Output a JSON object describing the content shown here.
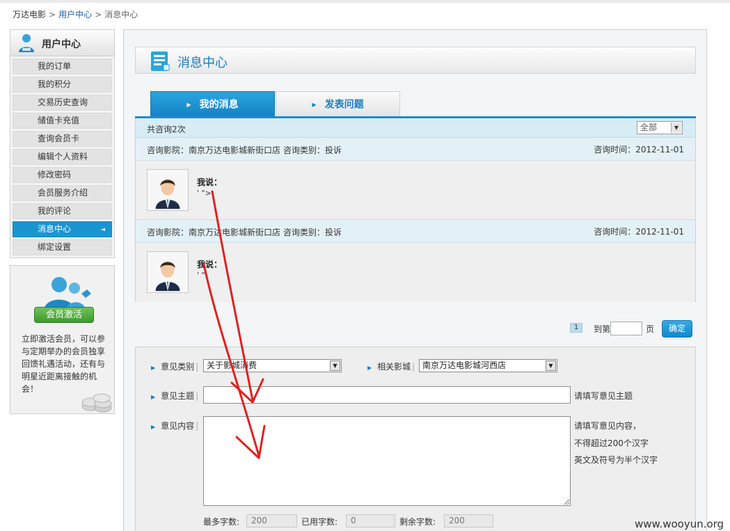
{
  "breadcrumb": {
    "home": "万达电影",
    "sep1": ">",
    "user_center": "用户中心",
    "sep2": ">",
    "current": "消息中心"
  },
  "sidebar": {
    "title": "用户中心",
    "items": [
      {
        "label": "我的订单"
      },
      {
        "label": "我的积分"
      },
      {
        "label": "交易历史查询"
      },
      {
        "label": "储值卡充值"
      },
      {
        "label": "查询会员卡"
      },
      {
        "label": "编辑个人资料"
      },
      {
        "label": "修改密码"
      },
      {
        "label": "会员服务介绍"
      },
      {
        "label": "我的评论"
      },
      {
        "label": "消息中心",
        "active": true
      },
      {
        "label": "绑定设置"
      }
    ]
  },
  "promo": {
    "button_label": "会员激活",
    "text": "立即激活会员，可以参与定期举办的会员独享回馈礼遇活动，还有与明星近距离接触的机会！"
  },
  "page_title": "消息中心",
  "tabs": [
    {
      "label": "我的消息",
      "active": true
    },
    {
      "label": "发表问题",
      "active": false
    }
  ],
  "messages_summary": {
    "count_text": "共咨询2次",
    "filter_value": "全部"
  },
  "messages": [
    {
      "cinema_info": "咨询影院：南京万达电影城新街口店 咨询类别：投诉",
      "time_info": "咨询时间：2012-11-01",
      "speaker": "我说：",
      "content": "' \">"
    },
    {
      "cinema_info": "咨询影院：南京万达电影城新街口店 咨询类别：投诉",
      "time_info": "咨询时间：2012-11-01",
      "speaker": "我说：",
      "content": "' \""
    }
  ],
  "pager": {
    "current_page": "1",
    "goto_label": "到第",
    "page_unit": "页",
    "confirm_label": "确定"
  },
  "form": {
    "category_label": "意见类别",
    "category_value": "关于影城消费",
    "cinema_label": "相关影城",
    "cinema_value": "南京万达电影城河西店",
    "subject_label": "意见主题",
    "subject_hint": "请填写意见主题",
    "content_label": "意见内容",
    "content_hint": [
      "请填写意见内容，",
      "不得超过200个汉字",
      "英文及符号为半个汉字"
    ],
    "max_label": "最多字数:",
    "max_value": "200",
    "used_label": "已用字数:",
    "used_value": "0",
    "remain_label": "剩余字数:",
    "remain_value": "200"
  },
  "watermark": "www.wooyun.org",
  "colors": {
    "accent_blue": "#1b95d0",
    "title_blue": "#1a7dbb",
    "annotation_red": "#e02020",
    "activate_green": "#4fad3b"
  }
}
